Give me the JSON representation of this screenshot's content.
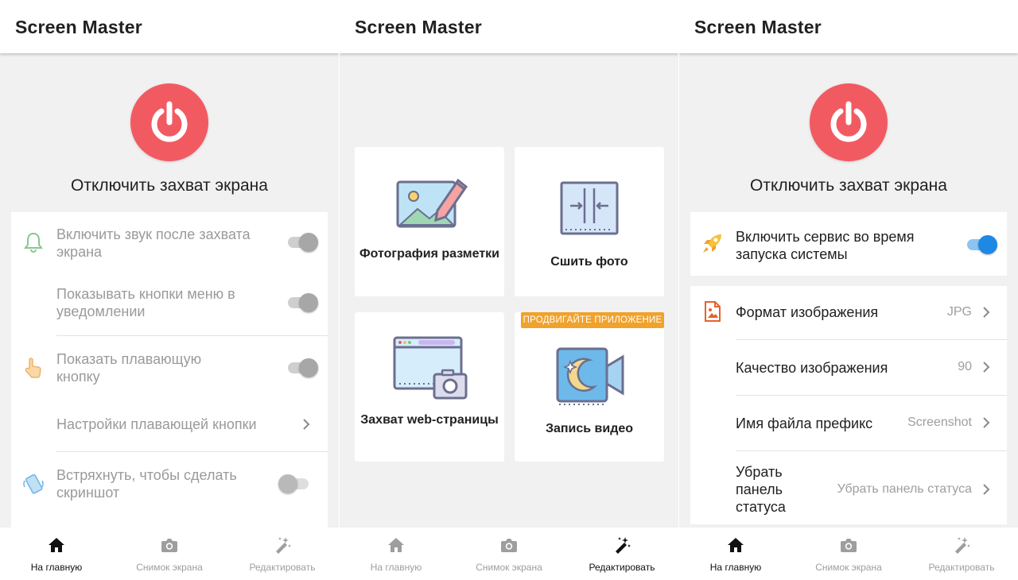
{
  "colors": {
    "power_red": "#f25a61",
    "toggle_blue": "#1e88e5",
    "promo_orange": "#f0a22a"
  },
  "screens": [
    {
      "app_title": "Screen Master",
      "capture_title": "Отключить захват экрана",
      "settings": [
        {
          "label": "Включить звук после захвата экрана",
          "icon": "bell-icon",
          "toggle": "on"
        },
        {
          "label": "Показывать кнопки меню в уведомлении",
          "toggle": "on"
        },
        {
          "label": "Показать плавающую кнопку",
          "icon": "hand-pointer-icon",
          "toggle": "on"
        },
        {
          "label": "Настройки плавающей кнопки",
          "chevron": true
        },
        {
          "label": "Встряхнуть, чтобы сделать скриншот",
          "icon": "shake-phone-icon",
          "toggle": "off"
        }
      ],
      "nav": [
        {
          "label": "На главную",
          "icon": "home-icon",
          "active": true
        },
        {
          "label": "Снимок экрана",
          "icon": "camera-icon",
          "active": false
        },
        {
          "label": "Редактировать",
          "icon": "magic-wand-icon",
          "active": false
        }
      ]
    },
    {
      "app_title": "Screen Master",
      "tiles": [
        {
          "label": "Фотография разметки",
          "icon": "annotate-photo-icon"
        },
        {
          "label": "Сшить фото",
          "icon": "stitch-photo-icon"
        },
        {
          "label": "Захват web-страницы",
          "icon": "web-capture-icon"
        },
        {
          "label": "Запись видео",
          "icon": "video-record-icon",
          "badge": "ПРОДВИГАЙТЕ ПРИЛОЖЕНИЕ"
        }
      ],
      "nav": [
        {
          "label": "На главную",
          "icon": "home-icon",
          "active": false
        },
        {
          "label": "Снимок экрана",
          "icon": "camera-icon",
          "active": false
        },
        {
          "label": "Редактировать",
          "icon": "magic-wand-icon",
          "active": true
        }
      ]
    },
    {
      "app_title": "Screen Master",
      "capture_title": "Отключить захват экрана",
      "service_row": {
        "label": "Включить сервис во время запуска системы",
        "icon": "rocket-icon",
        "toggle": "on"
      },
      "settings": [
        {
          "label": "Формат изображения",
          "value": "JPG",
          "icon": "image-file-icon"
        },
        {
          "label": "Качество изображения",
          "value": "90"
        },
        {
          "label": "Имя файла префикс",
          "value": "Screenshot"
        },
        {
          "label": "Убрать панель статуса",
          "value": "Убрать панель статуса"
        }
      ],
      "nav": [
        {
          "label": "На главную",
          "icon": "home-icon",
          "active": true
        },
        {
          "label": "Снимок экрана",
          "icon": "camera-icon",
          "active": false
        },
        {
          "label": "Редактировать",
          "icon": "magic-wand-icon",
          "active": false
        }
      ]
    }
  ]
}
